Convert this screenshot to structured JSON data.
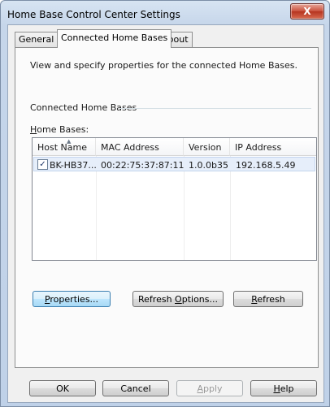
{
  "window": {
    "title": "Home Base Control Center Settings",
    "close_glyph": "X"
  },
  "tabs": [
    {
      "label": "General",
      "active": false
    },
    {
      "label": "Connected Home Bases",
      "active": true
    },
    {
      "label": "About",
      "active": false
    }
  ],
  "panel": {
    "description": "View and specify properties for the connected Home Bases.",
    "group_label": "Connected Home Bases",
    "home_bases_label_mnemonic": "H",
    "home_bases_label_rest": "ome Bases:"
  },
  "list": {
    "columns": [
      "Host Name",
      "MAC Address",
      "Version",
      "IP Address"
    ],
    "sorted_column_icon": "sort-ascending-icon",
    "rows": [
      {
        "checked": true,
        "host": "BK-HB37...",
        "mac": "00:22:75:37:87:11",
        "version": "1.0.0b35",
        "ip": "192.168.5.49"
      }
    ]
  },
  "panel_buttons": {
    "properties": {
      "m": "P",
      "rest": "roperties..."
    },
    "refresh_options": {
      "pre": "Refresh ",
      "m": "O",
      "rest": "ptions..."
    },
    "refresh": {
      "m": "R",
      "rest": "efresh"
    }
  },
  "dialog_buttons": {
    "ok": "OK",
    "cancel": "Cancel",
    "apply": {
      "m": "A",
      "rest": "pply"
    },
    "help": {
      "m": "H",
      "rest": "elp"
    }
  }
}
